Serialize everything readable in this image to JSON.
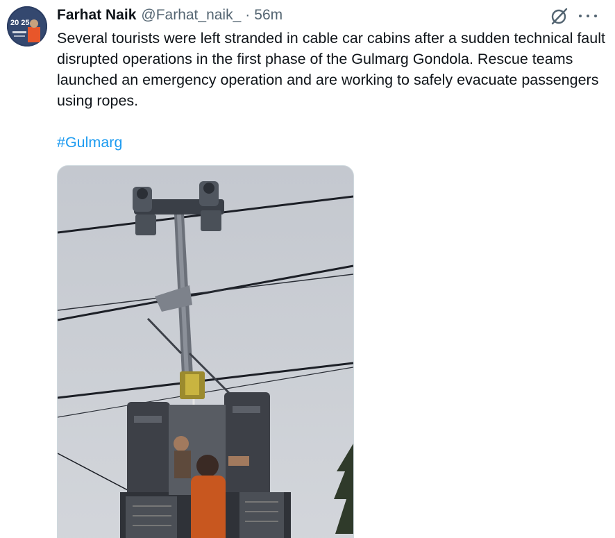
{
  "tweet": {
    "author_name": "Farhat Naik",
    "handle": "@Farhat_naik_",
    "separator": "·",
    "timestamp": "56m",
    "text": "Several tourists were left stranded in cable car cabins after a sudden technical fault disrupted operations in the first phase of the Gulmarg Gondola. Rescue teams launched an emergency operation and are working to safely evacuate passengers using ropes.",
    "hashtag": "#Gulmarg"
  },
  "avatar": {
    "badge_text": "20 25",
    "colors": {
      "background": "#2c3e63",
      "accent": "#e8562a"
    }
  },
  "icons": {
    "grok": "grok-icon",
    "more": "more-icon"
  },
  "colors": {
    "text": "#0f1419",
    "secondary": "#536471",
    "link": "#1d9bf0",
    "border": "#cfd9de"
  }
}
